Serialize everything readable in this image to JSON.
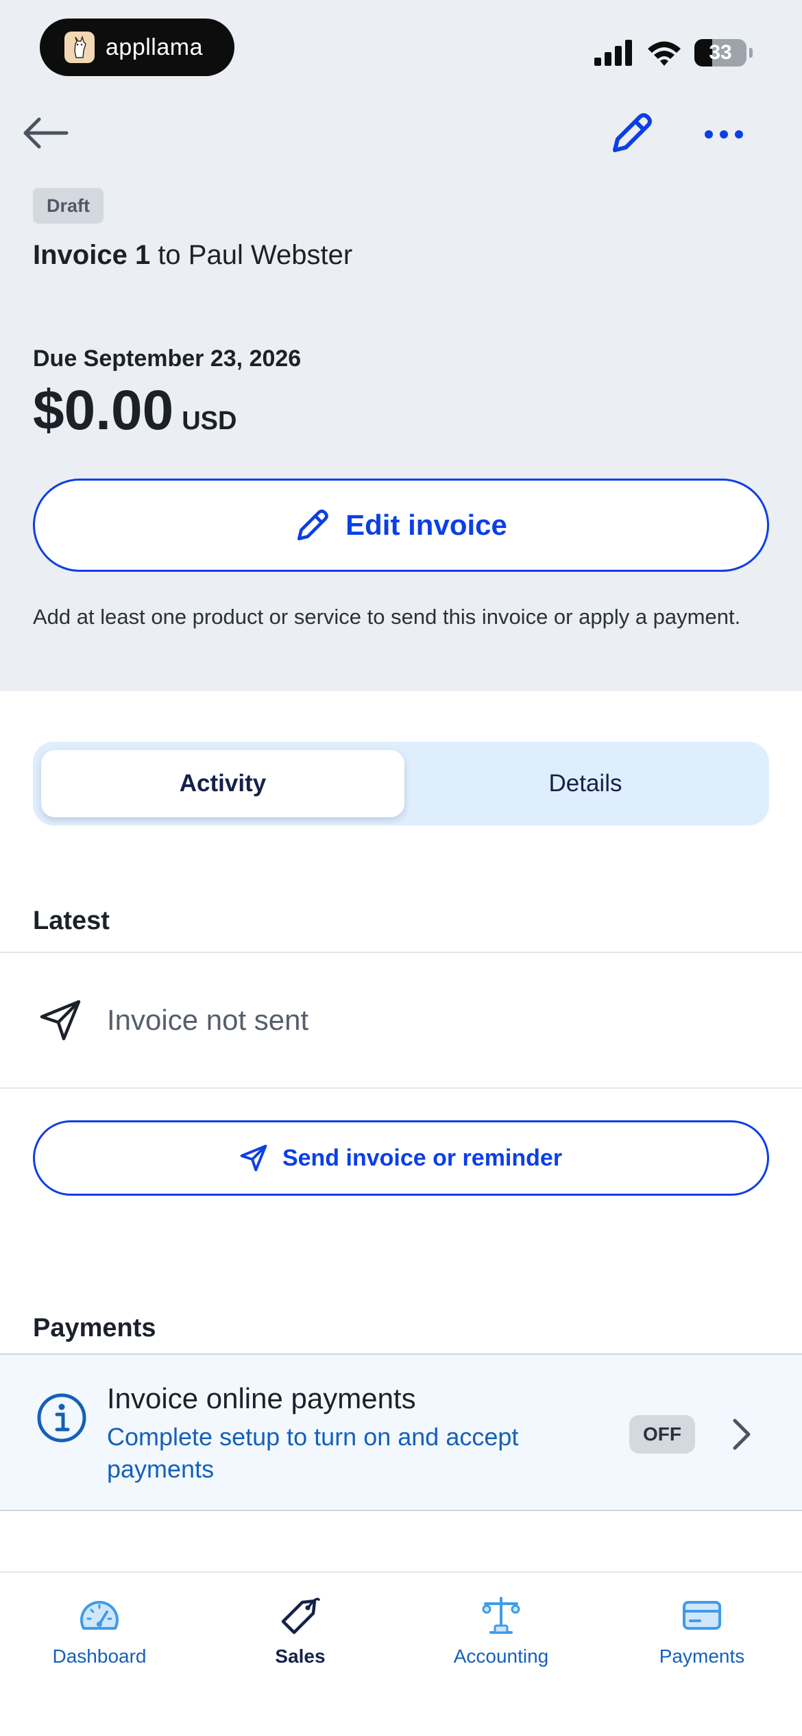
{
  "status_bar": {
    "brand": "appllama",
    "battery": "33"
  },
  "colors": {
    "accent_blue": "#0b3fe6",
    "link_blue": "#1560b8",
    "navy": "#15214a",
    "header_bg": "#ebeef2",
    "segment_bg": "#dfeefd",
    "payments_bg": "#f2f8fe"
  },
  "icons": {
    "back": "arrow-left-icon",
    "edit": "pencil-icon",
    "more": "more-horizontal-icon",
    "send": "paper-plane-icon",
    "info": "info-circle-icon",
    "chevron": "chevron-right-icon"
  },
  "invoice": {
    "status_badge": "Draft",
    "title_bold": "Invoice 1",
    "title_rest": " to Paul Webster",
    "due_label": "Due September 23, 2026",
    "amount": "$0.00",
    "currency": "USD",
    "edit_button": "Edit invoice",
    "hint": "Add at least one product or service to send this invoice or apply a payment."
  },
  "segments": {
    "active": "Activity",
    "inactive": "Details"
  },
  "activity": {
    "section_title": "Latest",
    "item_text": "Invoice not sent",
    "send_button": "Send invoice or reminder"
  },
  "payments": {
    "section_title": "Payments",
    "row_title": "Invoice online payments",
    "row_subtitle": "Complete setup to turn on and accept payments",
    "toggle_state": "OFF"
  },
  "tabbar": {
    "items": [
      {
        "label": "Dashboard",
        "icon": "speedometer-icon",
        "active": false
      },
      {
        "label": "Sales",
        "icon": "price-tag-icon",
        "active": true
      },
      {
        "label": "Accounting",
        "icon": "balance-scale-icon",
        "active": false
      },
      {
        "label": "Payments",
        "icon": "credit-card-icon",
        "active": false
      }
    ]
  }
}
